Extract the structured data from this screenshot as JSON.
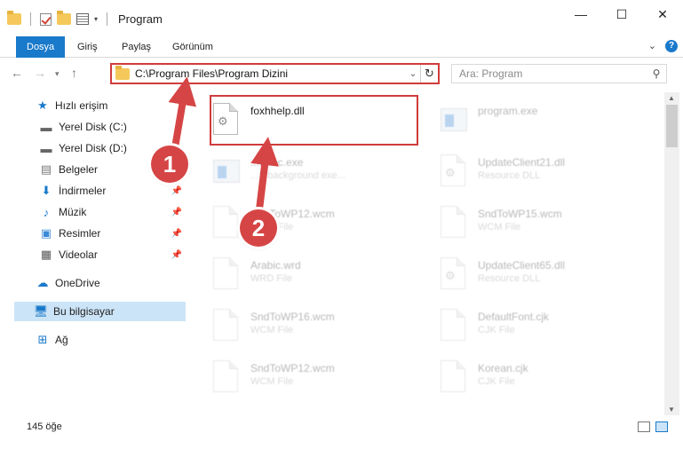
{
  "window": {
    "title": "Program",
    "minimize": "—",
    "maximize": "☐",
    "close": "✕"
  },
  "ribbon": {
    "tabs": [
      "Dosya",
      "Giriş",
      "Paylaş",
      "Görünüm"
    ],
    "expand": "⌄",
    "help": "?"
  },
  "address": {
    "path": "C:\\Program Files\\Program Dizini",
    "search_placeholder": "Ara: Program"
  },
  "nav": {
    "quick_access": "Hızlı erişim",
    "items": [
      {
        "label": "Yerel Disk (C:)"
      },
      {
        "label": "Yerel Disk (D:)"
      },
      {
        "label": "Belgeler"
      },
      {
        "label": "İndirmeler"
      },
      {
        "label": "Müzik"
      },
      {
        "label": "Resimler"
      },
      {
        "label": "Videolar"
      }
    ],
    "onedrive": "OneDrive",
    "this_pc": "Bu bilgisayar",
    "network": "Ağ"
  },
  "files": [
    {
      "name": "foxhhelp.dll",
      "sub": ""
    },
    {
      "name": "program.exe",
      "sub": ""
    },
    {
      "name": "...Exec.exe",
      "sub": "...Y background exe..."
    },
    {
      "name": "UpdateClient21.dll",
      "sub": "Resource DLL"
    },
    {
      "name": "SndToWP12.wcm",
      "sub": "WCM File"
    },
    {
      "name": "SndToWP15.wcm",
      "sub": "WCM File"
    },
    {
      "name": "Arabic.wrd",
      "sub": "WRD File"
    },
    {
      "name": "UpdateClient65.dll",
      "sub": "Resource DLL"
    },
    {
      "name": "SndToWP16.wcm",
      "sub": "WCM File"
    },
    {
      "name": "DefaultFont.cjk",
      "sub": "CJK File"
    },
    {
      "name": "SndToWP12.wcm",
      "sub": "WCM File"
    },
    {
      "name": "Korean.cjk",
      "sub": "CJK File"
    }
  ],
  "status": {
    "count": "145 öğe"
  },
  "annotations": {
    "step1": "1",
    "step2": "2"
  },
  "colors": {
    "accent": "#1979ca",
    "highlight": "#d03b3b",
    "selection": "#cce4f7"
  }
}
